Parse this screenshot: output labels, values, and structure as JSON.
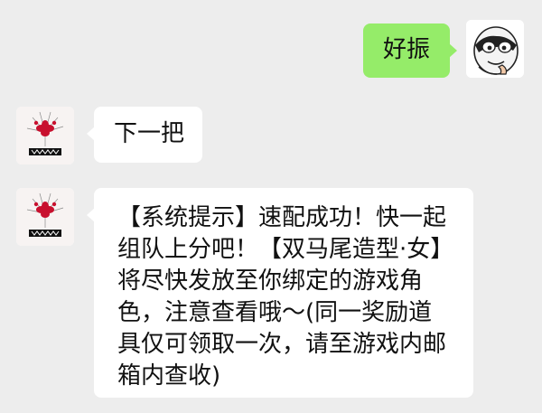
{
  "messages": [
    {
      "direction": "outgoing",
      "sender_avatar": "cartoon-avatar-icon",
      "text": "好振"
    },
    {
      "direction": "incoming",
      "sender_avatar": "red-spider-lily-avatar-icon",
      "text": "下一把"
    },
    {
      "direction": "incoming",
      "sender_avatar": "red-spider-lily-avatar-icon",
      "text": "【系统提示】速配成功！快一起组队上分吧！【双马尾造型·女】将尽快发放至你绑定的游戏角色，注意查看哦～(同一奖励道具仅可领取一次，请至游戏内邮箱内查收)"
    }
  ],
  "colors": {
    "background": "#ededed",
    "outgoing_bubble": "#95ec69",
    "incoming_bubble": "#ffffff",
    "text": "#111111"
  }
}
